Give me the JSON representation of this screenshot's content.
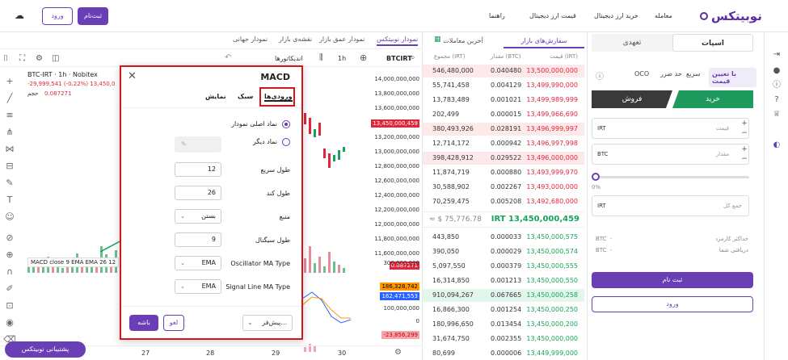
{
  "header": {
    "logo_text": "نوبیتکس",
    "nav": [
      "معامله",
      "خرید ارز دیجیتال",
      "قیمت ارز دیجیتال",
      "راهنما"
    ],
    "login_label": "ورود",
    "signup_label": "ثبت‌نام",
    "brand_color": "#6a3fb5"
  },
  "chart": {
    "tabs": [
      "نمودار نوبیتکس",
      "نمودار عمق بازار",
      "نقشه‌ی بازار",
      "نمودار جهانی"
    ],
    "symbol": "BTCIRT",
    "interval": "1h",
    "indicators_label": "اندیکاتورها",
    "legend_title": "BTC-IRT · 1h · Nobitex",
    "legend_change": "-29,999,541 (-0.22%) 13,450,0",
    "volume_label": "حجم",
    "volume_value": "0.087271",
    "macd_legend": "MACD close 9 EMA EMA 26 12",
    "price_axis": [
      "14,000,000,000",
      "13,800,000,000",
      "13,600,000,000",
      "13,450,000,459",
      "13,200,000,000",
      "13,000,000,000",
      "12,800,000,000",
      "12,600,000,000",
      "12,400,000,000",
      "12,200,000,000",
      "12,000,000,000",
      "11,800,000,000",
      "11,600,000,000"
    ],
    "volume_tag": "0.087271",
    "macd_axis": [
      "300,000,000",
      "186,328,742",
      "162,471,553",
      "100,000,000",
      "0",
      "-23,856,299"
    ],
    "time_axis": [
      "27",
      "28",
      "29",
      "30"
    ],
    "support_label": "پشتیبانی نوبیتکس"
  },
  "macd_modal": {
    "title": "MACD",
    "tabs": [
      "ورودی‌ها",
      "سبک",
      "نمایش"
    ],
    "radio_main": "نماد اصلی نمودار",
    "radio_other": "نماد دیگر",
    "fields": [
      {
        "label": "طول سریع",
        "value": "12"
      },
      {
        "label": "طول کند",
        "value": "26"
      },
      {
        "label": "منبع",
        "value": "بستن"
      },
      {
        "label": "طول سیگنال",
        "value": "9"
      },
      {
        "label": "Oscillator MA Type",
        "value": "EMA"
      },
      {
        "label": "Signal Line MA Type",
        "value": "EMA"
      }
    ],
    "ok_label": "باشه",
    "cancel_label": "لغو",
    "defaults_label": "پیش‌فر..."
  },
  "orderbook": {
    "tabs": [
      "سفارش‌های بازار",
      "آخرین معاملات"
    ],
    "headers": [
      "قیمت (IRT)",
      "مقدار (BTC)",
      "مجموع (IRT)"
    ],
    "asks": [
      [
        "13,500,000,000",
        "0.040480",
        "546,480,000"
      ],
      [
        "13,499,990,000",
        "0.004129",
        "55,741,458"
      ],
      [
        "13,499,989,999",
        "0.001021",
        "13,783,489"
      ],
      [
        "13,499,966,690",
        "0.000015",
        "202,499"
      ],
      [
        "13,496,999,997",
        "0.028191",
        "380,493,926"
      ],
      [
        "13,496,997,998",
        "0.000942",
        "12,714,172"
      ],
      [
        "13,496,000,000",
        "0.029522",
        "398,428,912"
      ],
      [
        "13,493,999,970",
        "0.000880",
        "11,874,719"
      ],
      [
        "13,493,000,000",
        "0.002267",
        "30,588,902"
      ],
      [
        "13,492,680,000",
        "0.005208",
        "70,259,475"
      ]
    ],
    "last_price": "IRT 13,450,000,459",
    "usd_price": "≈ $ 75,776.78",
    "bids": [
      [
        "13,450,000,575",
        "0.000033",
        "443,850"
      ],
      [
        "13,450,000,574",
        "0.000029",
        "390,050"
      ],
      [
        "13,450,000,555",
        "0.000379",
        "5,097,550"
      ],
      [
        "13,450,000,550",
        "0.001213",
        "16,314,850"
      ],
      [
        "13,450,000,258",
        "0.067665",
        "910,094,267"
      ],
      [
        "13,450,000,250",
        "0.001254",
        "16,866,300"
      ],
      [
        "13,450,000,200",
        "0.013454",
        "180,996,650"
      ],
      [
        "13,450,000,000",
        "0.002355",
        "31,674,750"
      ],
      [
        "13,449,999,000",
        "0.000006",
        "80,699"
      ]
    ]
  },
  "trade": {
    "tabs": [
      "اسپات",
      "تعهدی"
    ],
    "order_types": [
      "با تعیین قیمت",
      "سریع",
      "حد ضرر",
      "OCO"
    ],
    "buy_label": "خرید",
    "sell_label": "فروش",
    "price_label": "قیمت",
    "price_unit": "IRT",
    "amount_label": "مقدار",
    "amount_unit": "BTC",
    "slider_pct": "0%",
    "total_label": "جمع کل",
    "total_unit": "IRT",
    "fee_label": "حداکثر کارمزد",
    "receive_label": "دریافتی شما",
    "fee_unit": "BTC",
    "receive_unit": "BTC",
    "signup_label": "ثبت نام",
    "login_label": "ورود"
  }
}
